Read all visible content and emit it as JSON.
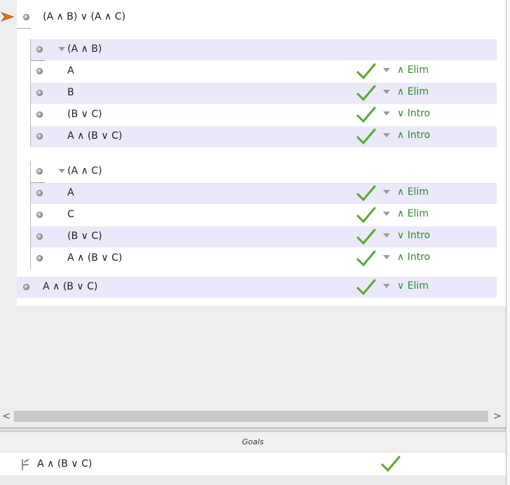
{
  "proof": {
    "premise": "(A ∧ B) ∨ (A ∧ C)",
    "subproof1": {
      "assumption": "(A ∧ B)",
      "lines": [
        {
          "formula": "A",
          "rule": "∧ Elim"
        },
        {
          "formula": "B",
          "rule": "∧ Elim"
        },
        {
          "formula": "(B  ∨ C)",
          "rule": "∨ Intro"
        },
        {
          "formula": "A ∧ (B ∨ C)",
          "rule": "∧ Intro"
        }
      ]
    },
    "subproof2": {
      "assumption": "(A ∧ C)",
      "lines": [
        {
          "formula": "A",
          "rule": "∧ Elim"
        },
        {
          "formula": "C",
          "rule": "∧ Elim"
        },
        {
          "formula": "(B ∨ C)",
          "rule": "∨ Intro"
        },
        {
          "formula": "A ∧ (B ∨ C)",
          "rule": "∧ Intro"
        }
      ]
    },
    "conclusion": {
      "formula": "A ∧ (B ∨ C)",
      "rule": "∨ Elim"
    }
  },
  "scrollbar": {
    "left_arrow": "<",
    "right_arrow": ">"
  },
  "goals": {
    "header": "Goals",
    "items": [
      {
        "formula": "A ∧ (B ∨ C)"
      }
    ]
  },
  "colors": {
    "rule_text": "#2e8b2e",
    "check": "#5aa832",
    "marker": "#e0702a",
    "alt_row": "#e9e9f9"
  },
  "icons": {
    "focus_marker": "focus-arrow-icon",
    "check": "check-icon",
    "bullet": "step-bullet-icon",
    "goal": "goal-turnstile-icon"
  }
}
